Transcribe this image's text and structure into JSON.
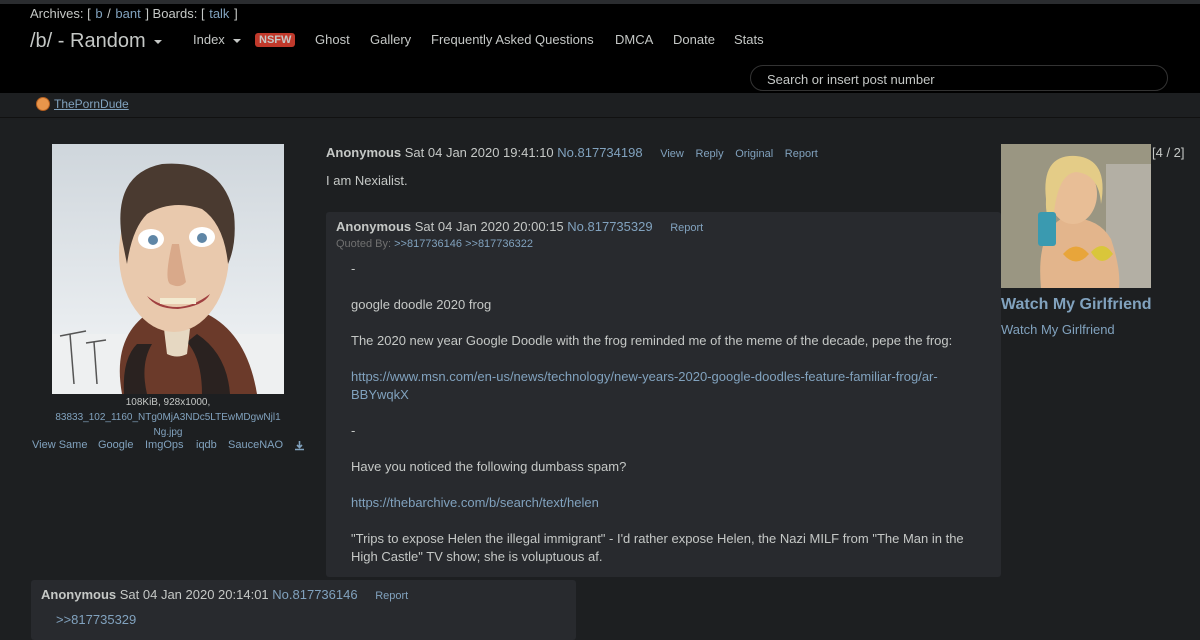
{
  "header": {
    "archives_label": "Archives: [",
    "archives": [
      "b",
      "bant"
    ],
    "boards_label": "] Boards: [",
    "boards": [
      "talk"
    ],
    "close_bracket": "]",
    "board_title": "/b/ - Random",
    "nav": {
      "index": "Index",
      "nsfw_badge": "NSFW",
      "ghost": "Ghost",
      "gallery": "Gallery",
      "faq": "Frequently Asked Questions",
      "dmca": "DMCA",
      "donate": "Donate",
      "stats": "Stats"
    },
    "search_placeholder": "Search or insert post number"
  },
  "sponsor": {
    "label": "ThePornDude"
  },
  "op": {
    "file_meta": "108KiB, 928x1000,",
    "file_name": "83833_102_1160_NTg0MjA3NDc5LTEwMDgwNjl1Ng.jpg",
    "file_tools": [
      "View Same",
      "Google",
      "ImgOps",
      "iqdb",
      "SauceNAO"
    ],
    "name": "Anonymous",
    "date": "Sat 04 Jan 2020 19:41:10",
    "number": "No.817734198",
    "actions": [
      "View",
      "Reply",
      "Original",
      "Report"
    ],
    "comment": "I am Nexialist."
  },
  "reply1": {
    "name": "Anonymous",
    "date": "Sat 04 Jan 2020 20:00:15",
    "number": "No.817735329",
    "report": "Report",
    "quoted_by_label": "Quoted By:",
    "quoted_by": [
      ">>817736146",
      ">>817736322"
    ],
    "lines": [
      "-",
      "google doodle 2020 frog",
      "The 2020 new year Google Doodle with the frog reminded me of the meme of the decade, pepe the frog:",
      "https://www.msn.com/en-us/news/technology/new-years-2020-google-doodles-feature-familiar-frog/ar-",
      "BBYwqkX",
      "-",
      "Have you noticed the following dumbass spam?",
      "https://thebarchive.com/b/search/text/helen",
      "\"Trips to expose Helen the illegal immigrant\" - I'd rather expose Helen, the Nazi MILF from \"The Man in the",
      "High Castle\" TV show; she is voluptuous af."
    ]
  },
  "reply2": {
    "name": "Anonymous",
    "date": "Sat 04 Jan 2020 20:14:01",
    "number": "No.817736146",
    "report": "Report",
    "quote": ">>817735329"
  },
  "ad": {
    "count": "[4 / 2]",
    "title": "Watch My Girlfriend",
    "subtitle": "Watch My Girlfriend"
  },
  "colors": {
    "background": "#1d1f21",
    "header": "#000000",
    "link": "#81a2be",
    "post_bg": "#282a2e",
    "nsfw": "#c0392b"
  }
}
